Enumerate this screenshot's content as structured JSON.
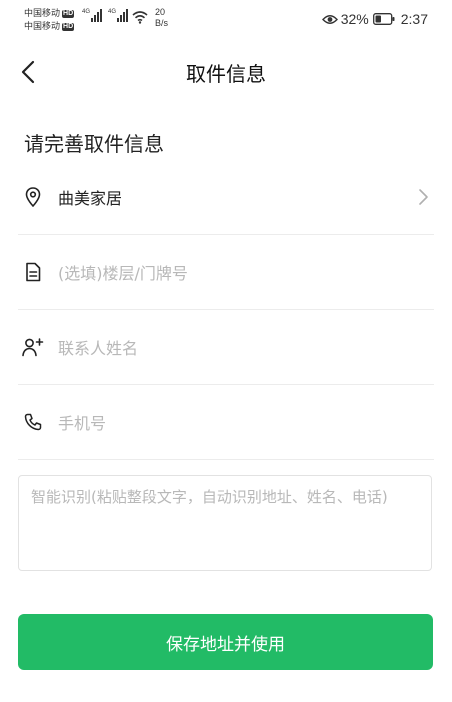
{
  "status_bar": {
    "carrier_1": "中国移动",
    "carrier_2": "中国移动",
    "hd_badge": "HD",
    "signal_label_1": "4G",
    "signal_label_2": "4G",
    "speed_value": "20",
    "speed_unit": "B/s",
    "battery_percent": "32%",
    "time": "2:37",
    "icons": [
      "signal-icon",
      "wifi-icon",
      "eye-icon",
      "battery-icon"
    ]
  },
  "nav": {
    "title": "取件信息",
    "back_icon": "chevron-left-icon"
  },
  "form": {
    "section_title": "请完善取件信息",
    "address": {
      "value": "曲美家居",
      "icon": "location-pin-icon",
      "chevron": "chevron-right-icon"
    },
    "floor": {
      "placeholder": "(选填)楼层/门牌号",
      "icon": "document-icon"
    },
    "contact_name": {
      "placeholder": "联系人姓名",
      "icon": "add-person-icon"
    },
    "phone": {
      "placeholder": "手机号",
      "icon": "phone-icon"
    },
    "smart_recognize": {
      "placeholder": "智能识别(粘贴整段文字，自动识别地址、姓名、电话)"
    }
  },
  "actions": {
    "save_label": "保存地址并使用"
  },
  "colors": {
    "primary_green": "#22bb66",
    "placeholder": "#b8b8b8",
    "divider": "#ececec"
  }
}
